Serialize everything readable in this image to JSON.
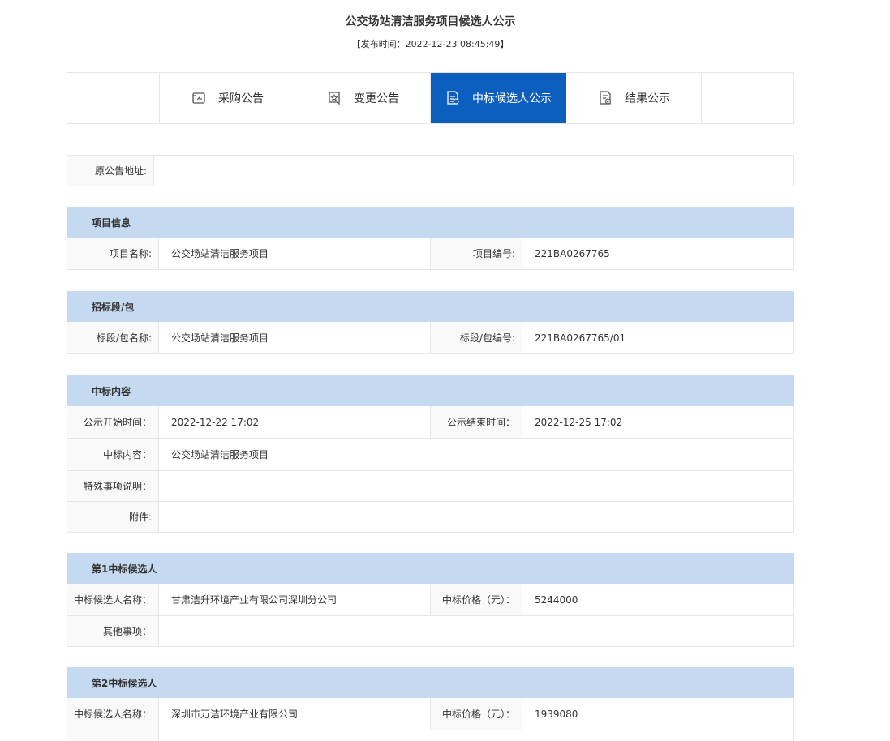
{
  "page": {
    "title": "公交场站清洁服务项目候选人公示",
    "publish_time": "【发布时间：2022-12-23 08:45:49】"
  },
  "tabs": [
    {
      "label": "采购公告",
      "icon": "document-upload-icon",
      "active": false
    },
    {
      "label": "变更公告",
      "icon": "document-star-icon",
      "active": false
    },
    {
      "label": "中标候选人公示",
      "icon": "document-list-icon",
      "active": true
    },
    {
      "label": "结果公示",
      "icon": "document-check-icon",
      "active": false
    }
  ],
  "original_notice": {
    "label": "原公告地址:",
    "value": ""
  },
  "project_info": {
    "header": "项目信息",
    "name_label": "项目名称:",
    "name_value": "公交场站清洁服务项目",
    "code_label": "项目编号:",
    "code_value": "221BA0267765"
  },
  "section": {
    "header": "招标段/包",
    "name_label": "标段/包名称:",
    "name_value": "公交场站清洁服务项目",
    "code_label": "标段/包编号:",
    "code_value": "221BA0267765/01"
  },
  "award": {
    "header": "中标内容",
    "start_label": "公示开始时间：",
    "start_value": "2022-12-22 17:02",
    "end_label": "公示结束时间：",
    "end_value": "2022-12-25 17:02",
    "content_label": "中标内容：",
    "content_value": "公交场站清洁服务项目",
    "special_label": "特殊事项说明：",
    "special_value": "",
    "attachment_label": "附件:",
    "attachment_value": ""
  },
  "candidate1": {
    "header": "第1中标候选人",
    "name_label": "中标候选人名称：",
    "name_value": "甘肃洁升环境产业有限公司深圳分公司",
    "price_label": "中标价格（元）：",
    "price_value": "5244000",
    "other_label": "其他事项：",
    "other_value": ""
  },
  "candidate2": {
    "header": "第2中标候选人",
    "name_label": "中标候选人名称：",
    "name_value": "深圳市万洁环境产业有限公司",
    "price_label": "中标价格（元）：",
    "price_value": "1939080"
  }
}
